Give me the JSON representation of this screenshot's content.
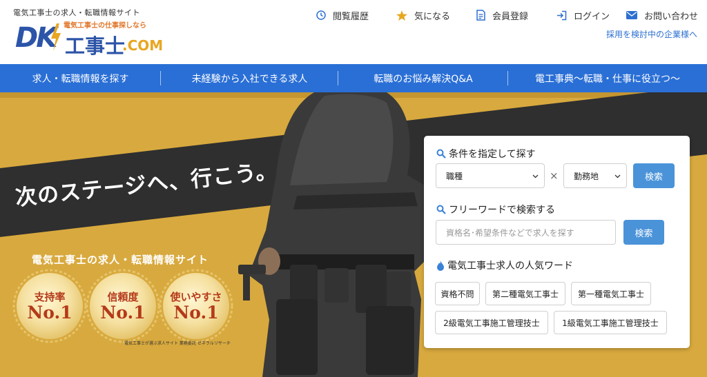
{
  "header": {
    "tagline": "電気工事士の求人・転職情報サイト",
    "logo": {
      "mark": "DK",
      "sub": "電気工事士の仕事探しなら",
      "main": "工事士",
      "com": ".COM"
    },
    "nav": [
      {
        "icon": "clock-icon",
        "label": "閲覧履歴"
      },
      {
        "icon": "star-icon",
        "label": "気になる"
      },
      {
        "icon": "document-icon",
        "label": "会員登録"
      },
      {
        "icon": "login-icon",
        "label": "ログイン"
      },
      {
        "icon": "mail-icon",
        "label": "お問い合わせ"
      }
    ],
    "recruit_link": "採用を検討中の企業様へ"
  },
  "main_nav": [
    "求人・転職情報を探す",
    "未経験から入社できる求人",
    "転職のお悩み解決Q&A",
    "電工事典〜転職・仕事に役立つ〜"
  ],
  "hero": {
    "headline": "次のステージへ、行こう。",
    "subtitle": "電気工事士の求人・転職情報サイト",
    "badges": [
      {
        "label": "支持率",
        "rank": "No.1"
      },
      {
        "label": "信頼度",
        "rank": "No.1"
      },
      {
        "label": "使いやすさ",
        "rank": "No.1"
      }
    ],
    "badge_note": "電気工事士が選ぶ求人サイト 業務委託 ゼネラルリサーチ"
  },
  "search": {
    "condition_heading": "条件を指定して探す",
    "job_select": "職種",
    "times": "×",
    "location_select": "勤務地",
    "search_button": "検索",
    "freeword_heading": "フリーワードで検索する",
    "freeword_placeholder": "資格名･希望条件などで求人を探す",
    "freeword_button": "検索",
    "popular_heading": "電気工事士求人の人気ワード",
    "popular_tags": [
      "資格不問",
      "第二種電気工事士",
      "第一種電気工事士",
      "2級電気工事施工管理技士",
      "1級電気工事施工管理技士"
    ]
  },
  "colors": {
    "brand_blue": "#2a6fd6",
    "logo_orange": "#e2772b",
    "search_button": "#4a93d9",
    "hero_gold": "#d8a93e"
  }
}
